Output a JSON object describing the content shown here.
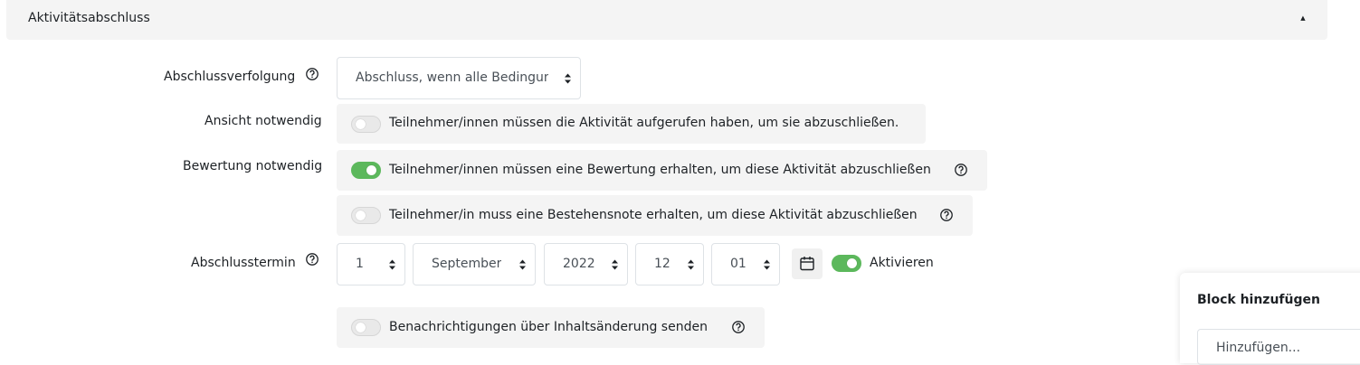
{
  "section": {
    "title": "Aktivitätsabschluss"
  },
  "completion_tracking": {
    "label": "Abschlussverfolgung",
    "value": "Abschluss, wenn alle Bedingungen erfüllt sind"
  },
  "view_required": {
    "label": "Ansicht notwendig",
    "text": "Teilnehmer/innen müssen die Aktivität aufgerufen haben, um sie abzuschließen.",
    "enabled": false
  },
  "grade_required": {
    "label": "Bewertung notwendig",
    "text": "Teilnehmer/innen müssen eine Bewertung erhalten, um diese Aktivität abzuschließen",
    "enabled": true
  },
  "pass_grade": {
    "text": "Teilnehmer/in muss eine Bestehensnote erhalten, um diese Aktivität abzuschließen",
    "enabled": false
  },
  "completion_date": {
    "label": "Abschlusstermin",
    "day": "1",
    "month": "September",
    "year": "2022",
    "hour": "12",
    "minute": "01",
    "enable_label": "Aktivieren",
    "enabled": true
  },
  "notify": {
    "text": "Benachrichtigungen über Inhaltsänderung senden",
    "enabled": false
  },
  "add_block": {
    "title": "Block hinzufügen",
    "select_value": "Hinzufügen..."
  },
  "colors": {
    "toggle_on": "#5cb85c",
    "panel_bg": "#f4f4f4"
  }
}
